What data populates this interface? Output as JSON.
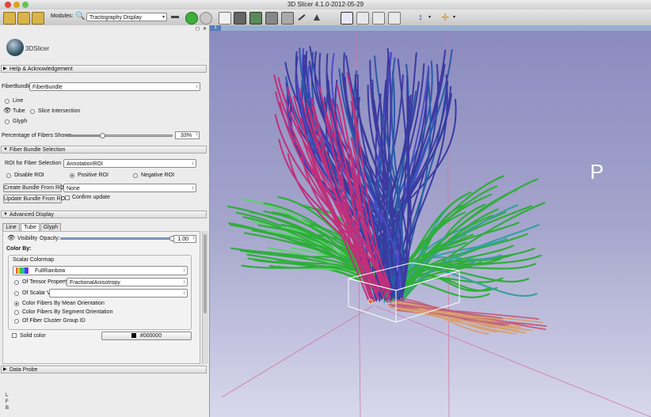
{
  "window": {
    "title": "3D Slicer 4.1.0-2012-05-29"
  },
  "toolbar": {
    "modules_label": "Modules:",
    "module_selected": "Tractography Display"
  },
  "panel": {
    "logo_text": "3DSlicer",
    "help_section": "Help & Acknowledgement",
    "fiberbundle_label": "FiberBundle:",
    "fiberbundle_value": "FiberBundle",
    "display_modes": [
      {
        "label": "Line"
      },
      {
        "label": "Tube"
      },
      {
        "label": "Glyph"
      }
    ],
    "slice_intersection_label": "Slice Intersection",
    "percentage_label": "Percentage of Fibers Shown",
    "percentage_value": "33%",
    "percentage_fraction": 0.33,
    "fiber_bundle_selection": "Fiber Bundle Selection",
    "roi_label": "ROI for Fiber Selection",
    "roi_value": "AnnotationROI",
    "roi_modes": [
      {
        "label": "Disable ROI"
      },
      {
        "label": "Positive ROI"
      },
      {
        "label": "Negative ROI"
      }
    ],
    "create_bundle_button": "Create Bundle From ROI",
    "create_bundle_value": "None",
    "update_bundle_button": "Update Bundle From ROI",
    "confirm_update_label": "Confirm update",
    "advanced_display": "Advanced Display",
    "tabs": [
      {
        "label": "Line"
      },
      {
        "label": "Tube"
      },
      {
        "label": "Glyph"
      }
    ],
    "visibility_label": "Visibility",
    "opacity_label": "Opacity:",
    "opacity_value": "1.00",
    "opacity_fraction": 1.0,
    "color_by_label": "Color By:",
    "scalar_colormap_label": "Scalar Colormap",
    "colormap_value": "FullRainbow",
    "tensor_property_label": "Of Tensor Property",
    "tensor_property_value": "FractionalAnisotropy",
    "scalar_value_label": "Of Scalar Value",
    "scalar_value_value": "",
    "color_options": [
      {
        "label": "Color Fibers By Mean Orientation"
      },
      {
        "label": "Color Fibers By Segment Orientation"
      },
      {
        "label": "Of Fiber Cluster Group ID"
      }
    ],
    "solid_color_label": "Solid color",
    "solid_color_value": "#000000",
    "data_probe": "Data Probe",
    "probe_lines": [
      "L",
      "F",
      "B"
    ]
  },
  "view": {
    "pin_label": "1",
    "orientation_label": "P"
  },
  "colors": {
    "accent": "#5a7db6",
    "fiber_blue": "#3a3aa0",
    "fiber_magenta": "#c0307a",
    "fiber_green": "#2fae3a",
    "roi_box": "#ffffff"
  }
}
